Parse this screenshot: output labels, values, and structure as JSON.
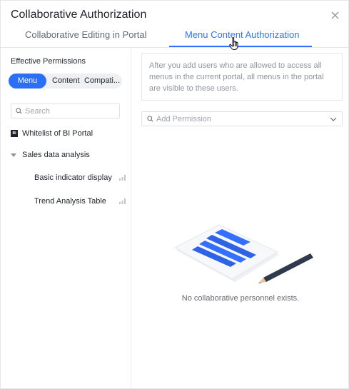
{
  "dialog": {
    "title": "Collaborative Authorization",
    "close_icon": "close-icon"
  },
  "tabs": [
    {
      "label": "Collaborative Editing in Portal",
      "active": false
    },
    {
      "label": "Menu Content Authorization",
      "active": true
    }
  ],
  "left": {
    "heading": "Effective Permissions",
    "segments": [
      "Menu",
      "Content",
      "Compati..."
    ],
    "active_segment": "Menu",
    "search_placeholder": "Search",
    "tree": {
      "root_label": "Whitelist of BI Portal",
      "root_icon_text": "BI",
      "folder_label": "Sales data analysis",
      "items": [
        {
          "label": "Basic indicator display",
          "icon": "bar-chart-icon"
        },
        {
          "label": "Trend Analysis Table",
          "icon": "bar-chart-icon"
        }
      ]
    }
  },
  "right": {
    "info_text": "After you add users who are allowed to access all menus in the current portal, all menus in the portal are visible to these users.",
    "add_permission_placeholder": "Add Permission",
    "empty_text": "No collaborative personnel exists."
  },
  "colors": {
    "accent": "#3370ff",
    "segment_active": "#2a6ff5",
    "border": "#e4e6ea",
    "muted_text": "#8f959e"
  }
}
